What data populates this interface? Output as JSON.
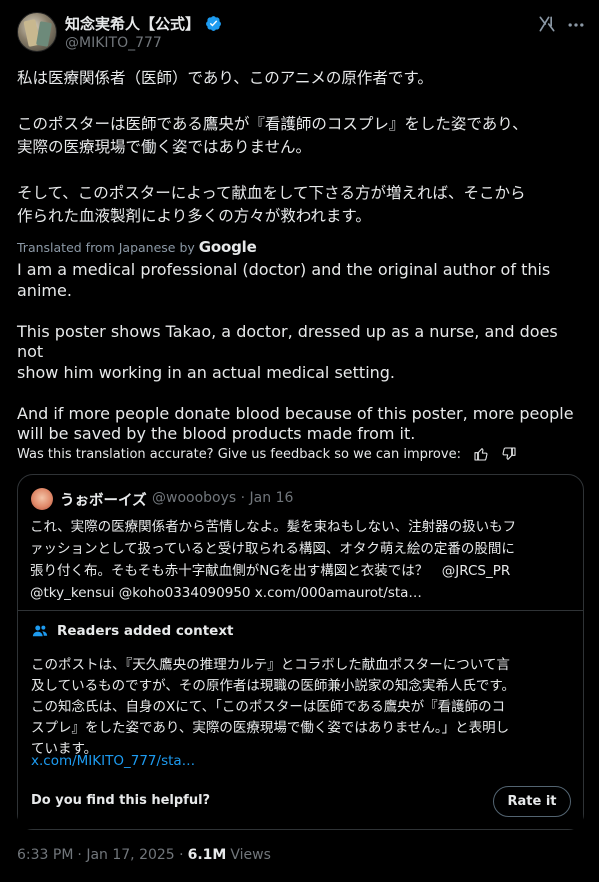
{
  "author": {
    "name": "知念実希人【公式】",
    "handle": "@MIKITO_777",
    "verified_color": "#1d9bf0"
  },
  "header_icons": [
    "grok-icon",
    "more-icon"
  ],
  "tweet": {
    "text_ja": "私は医療関係者（医師）であり、このアニメの原作者です。\n\nこのポスターは医師である鷹央が『看護師のコスプレ』をした姿であり、\n実際の医療現場で働く姿ではありません。\n\nそして、このポスターによって献血をして下さる方が増えれば、そこから\n作られた血液製剤により多くの方々が救われます。",
    "translated_label": "Translated from Japanese by",
    "translator": "Google",
    "text_en": "I am a medical professional (doctor) and the original author of this\nanime.\n\nThis poster shows Takao, a doctor, dressed up as a nurse, and does not\nshow him working in an actual medical setting.\n\nAnd if more people donate blood because of this poster, more people\nwill be saved by the blood products made from it.",
    "feedback_prompt": "Was this translation accurate? Give us feedback so we can improve:"
  },
  "quote": {
    "name": "うぉボーイズ",
    "handle": "@woooboys",
    "date": "· Jan 16",
    "text": "これ、実際の医療関係者から苦情しなよ。髪を束ねもしない、注射器の扱いもフ\nァッションとして扱っていると受け取られる構図、オタク萌え絵の定番の股間に\n張り付く布。そもそも赤十字献血側がNGを出す構図と衣装では？　@JRCS_PR\n@tky_kensui @koho0334090950 x.com/000amaurot/sta…"
  },
  "context": {
    "title": "Readers added context",
    "text": "このポストは、『天久鷹央の推理カルテ』とコラボした献血ポスターについて言\n及しているものですが、その原作者は現職の医師兼小説家の知念実希人氏です。\nこの知念氏は、自身のXにて、「このポスターは医師である鷹央が『看護師のコ\nスプレ』をした姿であり、実際の医療現場で働く姿ではありません。」と表明し\nています。",
    "link": "x.com/MIKITO_777/sta…",
    "helpful_prompt": "Do you find this helpful?",
    "rate_label": "Rate it"
  },
  "footer": {
    "time": "6:33 PM",
    "date": "· Jan 17, 2025 ·",
    "views_count": "6.1M",
    "views_label": "Views"
  },
  "colors": {
    "background": "#000000",
    "text": "#e7e9ea",
    "muted": "#71767b",
    "link": "#1d9bf0",
    "border": "#2f3336"
  }
}
